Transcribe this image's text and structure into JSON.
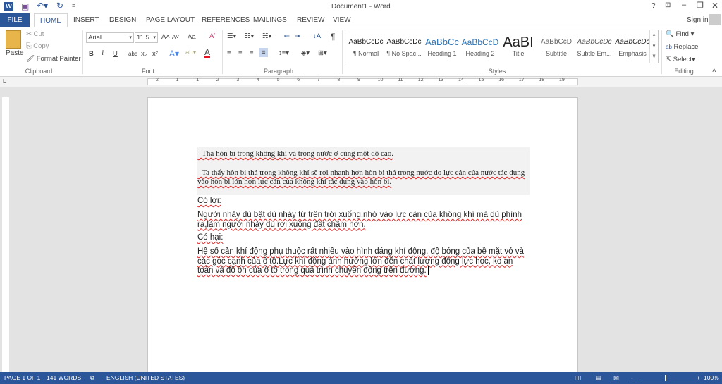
{
  "window": {
    "title": "Document1 - Word",
    "help": "?",
    "sign_in": "Sign in"
  },
  "quick_access": {
    "icons": [
      "word-logo-icon",
      "save-icon",
      "undo-icon",
      "redo-icon",
      "customize-icon"
    ]
  },
  "tabs": [
    "FILE",
    "HOME",
    "INSERT",
    "DESIGN",
    "PAGE LAYOUT",
    "REFERENCES",
    "MAILINGS",
    "REVIEW",
    "VIEW"
  ],
  "clipboard": {
    "paste": "Paste",
    "cut": "Cut",
    "copy": "Copy",
    "format_painter": "Format Painter",
    "label": "Clipboard"
  },
  "font": {
    "name": "Arial",
    "size": "11.5",
    "label": "Font",
    "change_case": "Aa",
    "bold": "B",
    "italic": "I",
    "underline": "U",
    "strike": "abc",
    "subscript": "x₂",
    "superscript": "x²",
    "font_color": "#e81123"
  },
  "paragraph": {
    "label": "Paragraph",
    "pilcrow": "¶"
  },
  "styles": {
    "label": "Styles",
    "items": [
      {
        "preview": "AaBbCcDc",
        "name": "¶ Normal"
      },
      {
        "preview": "AaBbCcDc",
        "name": "¶ No Spac..."
      },
      {
        "preview": "AaBbCc",
        "name": "Heading 1"
      },
      {
        "preview": "AaBbCcD",
        "name": "Heading 2"
      },
      {
        "preview": "AaBI",
        "name": "Title"
      },
      {
        "preview": "AaBbCcD",
        "name": "Subtitle"
      },
      {
        "preview": "AaBbCcDc",
        "name": "Subtle Em..."
      },
      {
        "preview": "AaBbCcDc",
        "name": "Emphasis"
      }
    ]
  },
  "editing": {
    "find": "Find",
    "replace": "Replace",
    "select": "Select",
    "label": "Editing"
  },
  "ruler": {
    "marks": [
      "2",
      "1",
      "1",
      "2",
      "3",
      "4",
      "5",
      "6",
      "7",
      "8",
      "9",
      "10",
      "11",
      "12",
      "13",
      "14",
      "15",
      "16",
      "17",
      "18",
      "19"
    ]
  },
  "document": {
    "p1": "- Thả hòn bi trong không khí và trong nước ở cùng một độ cao.",
    "p2": "- Ta thấy hòn bi thả trong không khí sẽ rơi nhanh hơn hòn bi thả trong nước do lực cản của nước tác dụng vào hòn bi lớn hơn lực cản của không khí tác dụng vào hòn bi.",
    "h1": "Có lợi:",
    "p3": "Người nhảy dù bật dù nhảy từ trên trời xuống,nhờ vào lực cản của không khí mà dù phình ra,làm người nhảy dù rơi xuống đất chậm hơn.",
    "h2": "Có hại:",
    "p4": "Hệ số cản khí động phụ thuộc rất nhiều vào hình dáng khí động, độ bóng của bề mặt vỏ và các góc cạnh của ô tô.Lực khí động ảnh hưởng lớn đến chất lượng động lực học, ko an toàn và độ ồn của ô tô trong quá trình chuyển động trên đường."
  },
  "status": {
    "page": "PAGE 1 OF 1",
    "words": "141 WORDS",
    "language": "ENGLISH (UNITED STATES)",
    "zoom": "100%",
    "zoom_minus": "-",
    "zoom_plus": "+"
  },
  "colors": {
    "accent": "#2b579a",
    "shading": "#f2f2f2"
  }
}
